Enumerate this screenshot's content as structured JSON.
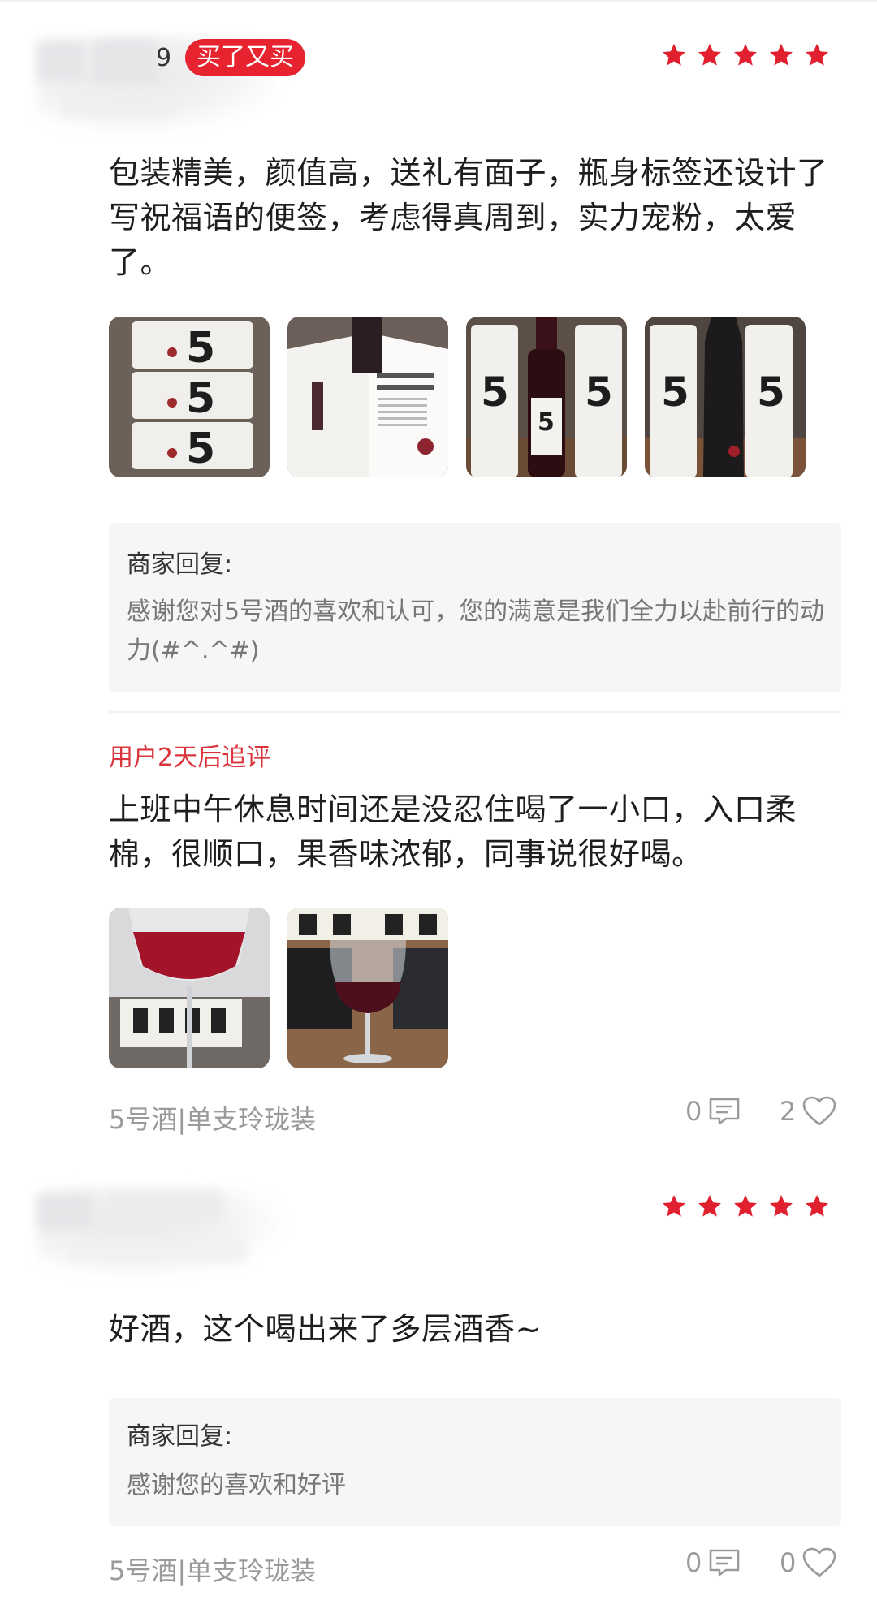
{
  "reviews": [
    {
      "username_tail": "9",
      "badge": "买了又买",
      "rating": 5,
      "text": "包装精美，颜值高，送礼有面子，瓶身标签还设计了写祝福语的便签，考虑得真周到，实力宠粉，太爱了。",
      "images": [
        "wine-gift-tubes-stack",
        "product-of-valencia-booklet",
        "wine-bottle-with-tubes",
        "wrapped-bottle-with-tubes"
      ],
      "merchant_reply": {
        "title": "商家回复:",
        "text": "感谢您对5号酒的喜欢和认可，您的满意是我们全力以赴前行的动力(#^.^#)"
      },
      "followup": {
        "label": "用户2天后追评",
        "text": "上班中午休息时间还是没忍住喝了一小口，入口柔棉，很顺口，果香味浓郁，同事说很好喝。",
        "images": [
          "red-wine-glass-calligraphy",
          "wine-glass-office-desk"
        ]
      },
      "spec": "5号酒|单支玲珑装",
      "comment_count": "0",
      "like_count": "2"
    },
    {
      "rating": 5,
      "text": "好酒，这个喝出来了多层酒香~",
      "merchant_reply": {
        "title": "商家回复:",
        "text": "感谢您的喜欢和好评"
      },
      "spec": "5号酒|单支玲珑装",
      "comment_count": "0",
      "like_count": "0"
    }
  ],
  "colors": {
    "accent_red": "#e6232f",
    "star_red": "#e0202e",
    "followup_red": "#d8353c",
    "muted_text": "#9a9a9a",
    "reply_bg": "#f6f6f8"
  },
  "icons": {
    "star": "star-icon",
    "comment": "comment-icon",
    "like": "heart-icon"
  }
}
